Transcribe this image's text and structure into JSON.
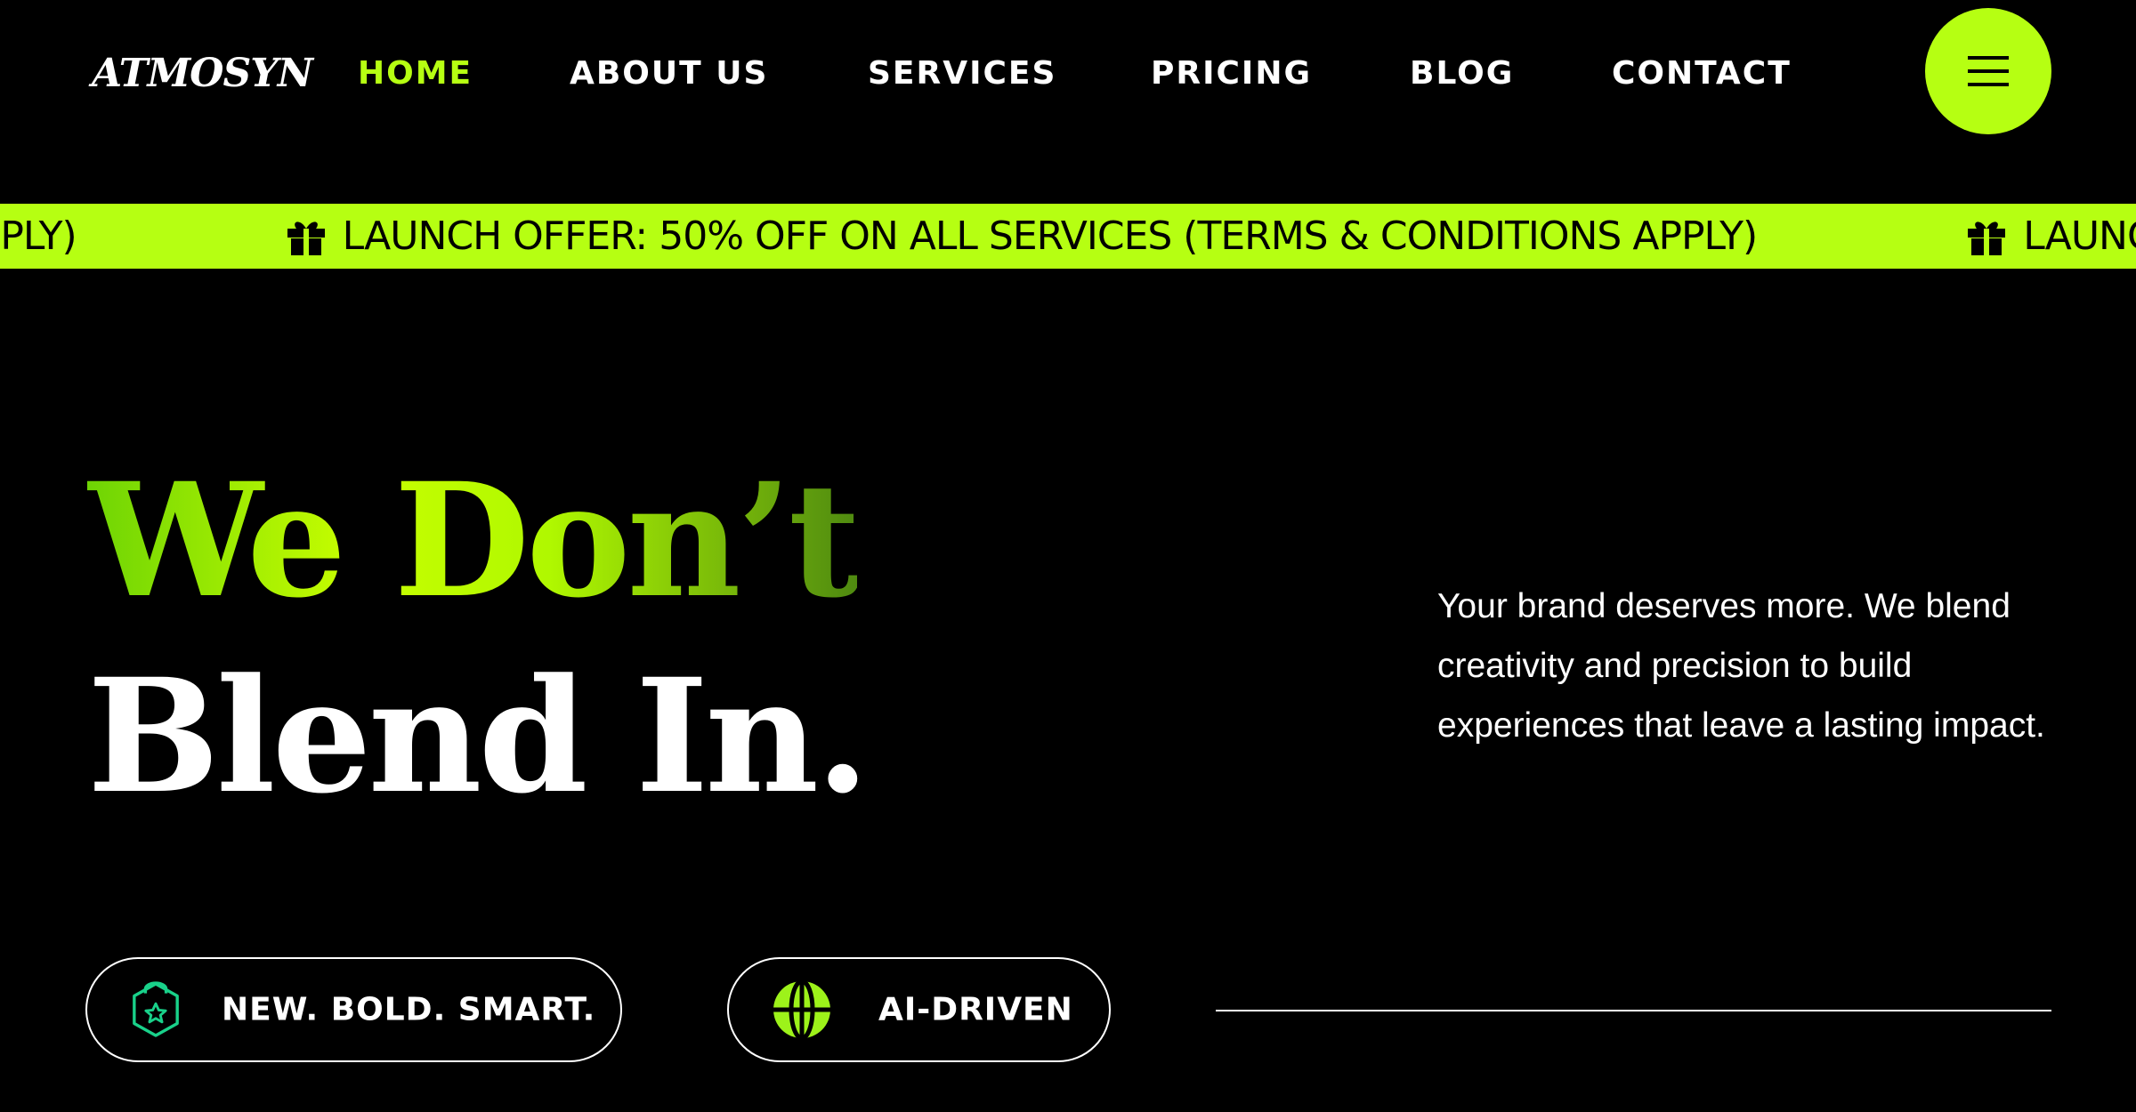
{
  "brand": {
    "logo_text": "ATMOSYN",
    "accent_color": "#b6ff12"
  },
  "nav": {
    "items": [
      {
        "label": "HOME",
        "active": true
      },
      {
        "label": "ABOUT US",
        "active": false
      },
      {
        "label": "SERVICES",
        "active": false
      },
      {
        "label": "PRICING",
        "active": false
      },
      {
        "label": "BLOG",
        "active": false
      },
      {
        "label": "CONTACT",
        "active": false
      }
    ],
    "menu_icon": "hamburger-icon"
  },
  "ticker": {
    "icon": "gift-icon",
    "text": "LAUNCH OFFER: 50% OFF ON ALL SERVICES (TERMS & CONDITIONS APPLY)"
  },
  "hero": {
    "headline_line1": "We Don’t",
    "headline_line2": "Blend In.",
    "description": "Your brand deserves more. We blend creativity and precision to build experiences that leave a lasting impact."
  },
  "pills": [
    {
      "label": "NEW. BOLD. SMART.",
      "icon": "shield-badge-icon"
    },
    {
      "label": "AI-DRIVEN",
      "icon": "globe-icon"
    }
  ]
}
